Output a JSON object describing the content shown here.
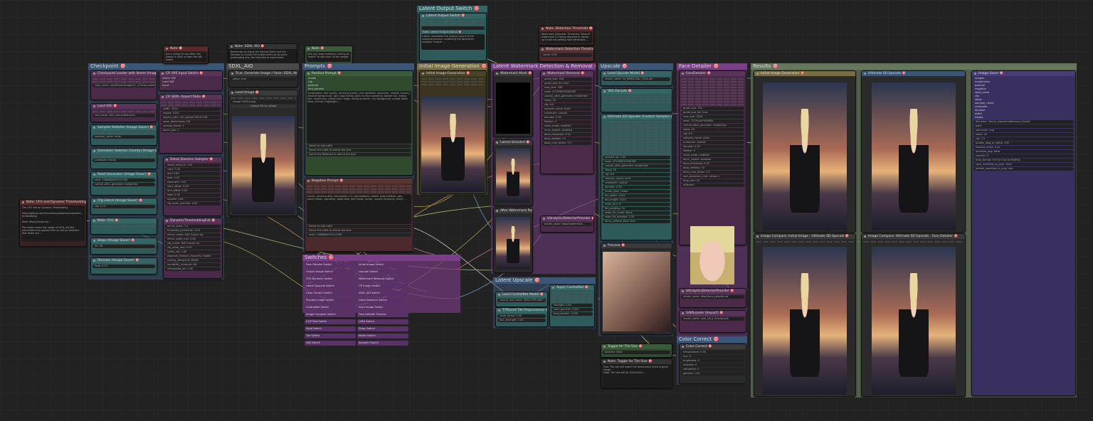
{
  "canvas": {
    "groups": {
      "checkpoint": "Checkpoint 🎯",
      "sdxl_aio": "SDXL_AIO",
      "prompts": "Prompts 🎯",
      "initial_gen": "Initial Image Generation 🎯",
      "watermark_removal": "Latent Watermark Detection & Removal 🎯",
      "upscale": "Upscale 🎯",
      "face_detailer": "Face Detailer 🎯",
      "results": "Results 🎯",
      "color_correct": "Color Correct 🎯",
      "latent_upscale": "Latent Upscale 🎯",
      "switches": "Switches 🎯"
    },
    "nodes": {
      "note_cfg": {
        "title": "Note: CFG and Dynamic Thresholding 🎯",
        "text": "The CFG Info on Dynamic Thresholding\n\nhttps://github.com/mcmonkeyprojects/sd-dynamic-thresholding\n\nNote: https://youtu.be/...\n\nThe video covers the usage of CFGs, but the parameters are applied here as well as samplers that make use ..."
      },
      "checkpoint_loader": {
        "title": "Checkpoint Loader with Name (Image Saver) 🎯",
        "ckpt": "ckpt_name: sdxl/DreamshaperXL_v2Turbo.safetensors"
      },
      "load_vae": {
        "title": "Load VAE 🎯",
        "vae": "vae_name: sdxl_vae.safetensors"
      },
      "sampler_selector": {
        "title": "Sampler Selector (Image Saver) 🎯",
        "sampler": "sampler_name: euler"
      },
      "scheduler_selector": {
        "title": "Scheduler Selector (Comfy) (Image Saver) 🎯",
        "scheduler": "scheduler: karras"
      },
      "seed_generator": {
        "title": "Seed Generator (Image Saver) 🎯",
        "seed": "seed: 1088884091512784",
        "control": "control_after_generate: randomize"
      },
      "cfg_literal": {
        "title": "Cfg Literal (Image Saver) 🎯",
        "cfg": "cfg: 11.0"
      },
      "note_cfg2": {
        "title": "Note: CFG 🎯"
      },
      "steps": {
        "title": "Steps (Image Saver) 🎯",
        "steps": "int: 28"
      },
      "denoise": {
        "title": "Denoise (Image Saver) 🎯",
        "denoise": "float: 0.70"
      },
      "cr_vae_switch": {
        "title": "CR VAE Input Switch 🎯",
        "inputs": [
          "Select VAE",
          "Load VAE",
          "Input"
        ]
      },
      "cr_sdxl_aspect": {
        "title": "CR SDXL Aspect Ratio 🎯",
        "width": "width: 1024",
        "height": "height: 1024",
        "aspect": "aspect_ratio: 4:5 portrait 832x1216",
        "swap": "swap_dimensions: Off",
        "upscale": "upscale_factor: 1",
        "batch": "batch_size: 1"
      },
      "detail_daemon": {
        "title": "Detail Daemon Sampler 🎯",
        "rows": [
          "detail_amount: 0.50",
          "start: 0.20",
          "end: 0.80",
          "bias: 0.50",
          "exponent: 1.00",
          "start_offset: 0.00",
          "end_offset: 0.00",
          "fade: 0.00",
          "smooth: true",
          "cfg_scale_override: 0.00"
        ]
      },
      "dynamic_threshold": {
        "title": "DynamicThresholdingFull 🎯",
        "rows": [
          "mimic_scale: 7.0",
          "threshold_percentile: 1.00",
          "mimic_mode: Half Cosine Up",
          "mimic_scale_min: 0.00",
          "cfg_mode: Half Cosine Up",
          "cfg_scale_min: 0.00",
          "sched_val: 1.00",
          "separate_feature_channels: enable",
          "scaling_startpoint: MEAN",
          "variability_measure: AD",
          "interpolate_phi: 1.00"
        ]
      },
      "note_sdxl": {
        "title": "Note: SDXL AIO 🎯"
      },
      "note_top1": {
        "title": "Note 🎯",
        "text": "Just a switch to say either the output is SDXL or from the VAE loader."
      },
      "note_top2": {
        "title": "Note: SDXL AIO 🎯",
        "text": "Remember to adjust the Sample Batch and the Denoise so usually the bright seems to do some preempting also, but that also to experiment."
      },
      "note_top3": {
        "title": "Note 🎯",
        "text": "Add your base model by clicking on \"select\" to add clips\" to the weight."
      },
      "true_generate": {
        "title": "True: Generate Image / False: SDXL AIO 🎯",
        "value": "value: true"
      },
      "load_image": {
        "title": "Load Image 🎯",
        "image": "image: 00024.png",
        "upload": "choose file to upload"
      },
      "positive_prompt": {
        "title": "Positive Prompt 🎯",
        "fields": [
          "model",
          "clip",
          "positive",
          "lora_params"
        ],
        "text": "masterpiece, best quality, amazing quality, very aesthetic, absurdres, newest, scenery, detailed background, 1girl, toga himiko, boku no hero academia, blonde hair, messy hair, double bun, yellow eyes, fangs, sitting on bench, city background, sunset, black dress, fishnet, thighhighs ..."
      },
      "lora_rows": {
        "a": "Select to add LoRA",
        "b": "Select the LoRA to add to the text",
        "c": "Select the Wildcard to add to the text"
      },
      "negative_prompt": {
        "title": "Negative Prompt 🎯",
        "text": "lowres, (worst quality, bad quality:1.2), bad anatomy, sketch, jpeg artifacts, ugly, poorly drawn, signature, watermark, bad hands, censor, mosaic censoring, blurry ..."
      },
      "seed_row": "seed: 1088884091512784",
      "latent_output_switch": {
        "title": "Latent Output Switch 🎯",
        "rows": [
          "Latent Output Switch 🎯",
          "Note: Latent Output Switch 🎯"
        ],
        "text": "Latent: represents the original output of the sampling process, containing the generated samples. Output: ..."
      },
      "initial_image": {
        "title": "Initial Image Generation 🎯"
      },
      "watermark_mask": {
        "title": "Watermark Mask 🎯"
      },
      "latent_detailed": {
        "title": "Latent Detailed 🎯"
      },
      "after_watermark": {
        "title": "After Watermark Removal 🎯"
      },
      "watermark_removal_node": {
        "title": "Watermark Removal 🎯",
        "rows": [
          "guide_size: 256",
          "guide_size_for: true",
          "max_size: 768",
          "seed: 472398349345382",
          "control_after_generate: randomize",
          "steps: 20",
          "cfg: 8.0",
          "sampler_name: euler",
          "scheduler: normal",
          "denoise: 0.50",
          "feather: 5",
          "noise_mask: enabled",
          "force_inpaint: enabled",
          "bbox_threshold: 0.50",
          "bbox_dilation: 10",
          "bbox_crop_factor: 3.0"
        ]
      },
      "note_watermark": {
        "title": "Note: Detection Threshold 🎯",
        "text": "Watermark Detection Threshold: Value of watermark 0.5 being detected or values up to but not getting false detections ..."
      },
      "watermark_threshold": {
        "title": "Watermark Detection Threshold 🎯",
        "value": "value: 0.50"
      },
      "ultralytics_provider": {
        "title": "UltralyticsDetectorProvider 🎯",
        "model": "model_name: bbox/watermark..."
      },
      "load_upscale": {
        "title": "Load Upscale Model 🎯",
        "model": "model_name: 4x_NMKD-Siax_200k.pth"
      },
      "sdxl_vae_decode": {
        "title": "VAE Decode 🎯"
      },
      "ultimate_sd_upscale": {
        "title": "Ultimate SD Upscale (Custom Sample) 🎯",
        "rows": [
          "upscale_by: 2.00",
          "seed: 472398349345382",
          "control_after_generate: randomize",
          "steps: 20",
          "cfg: 8.0",
          "sampler_name: euler",
          "scheduler: normal",
          "denoise: 0.20",
          "mode_type: Linear",
          "tile_width: 1024",
          "tile_height: 1024",
          "mask_blur: 8",
          "tile_padding: 32",
          "seam_fix_mode: None",
          "seam_fix_denoise: 1.00",
          "force_uniform_tiles: true"
        ]
      },
      "upscale_preview": {
        "title": "Preview 🎯"
      },
      "face_detailer_node": {
        "title": "FaceDetailer 🎯",
        "rows": [
          "guide_size: 512",
          "guide_size_for: true",
          "max_size: 1024",
          "seed: 72795447934586",
          "control_after_generate: randomize",
          "steps: 20",
          "cfg: 8.0",
          "sampler_name: euler",
          "scheduler: normal",
          "denoise: 0.50",
          "feather: 5",
          "noise_mask: enabled",
          "force_inpaint: enabled",
          "bbox_threshold: 0.50",
          "bbox_dilation: 10",
          "bbox_crop_factor: 3.0",
          "sam_detection_hint: center-1",
          "drop_size: 10",
          "wildcard: "
        ]
      },
      "face_preview": {
        "title": "Preview 🎯"
      },
      "ultralytics_face": {
        "title": "UltralyticsDetectorProvider 🎯",
        "model": "model_name: bbox/face_yolov8m.pt"
      },
      "sam_loader": {
        "title": "SAMLoader (Impact) 🎯",
        "model": "model_name: sam_vit_b_01ec64.pth"
      },
      "color_correct_node": {
        "title": "Color Correct 🎯",
        "rows": [
          "temperature: 0.00",
          "hue: 0",
          "brightness: 0",
          "contrast: 0",
          "saturation: 0",
          "gamma: 1.00"
        ]
      },
      "load_controlnet": {
        "title": "Load ControlNet Model 🎯",
        "model": "control_net_name: SDXL/TTPLANET..."
      },
      "apply_controlnet": {
        "title": "Apply ControlNet 🎯",
        "rows": [
          "strength: 0.60",
          "start_percent: 0.000",
          "end_percent: 1.000"
        ]
      },
      "ttp_tile": {
        "title": "TTPlanet Tile Preprocessor Simple 🎯",
        "rows": [
          "scale_factor: 2.00",
          "blur_strength: 2.00"
        ]
      },
      "toggle_tile": {
        "title": "Toggle for Tile Size 🎯",
        "value": "boolean: false"
      },
      "note_tile": {
        "title": "Note: Toggle for Tile Size 🎯",
        "text": "True: Tile size will match the dimensions of the original image\nFalse: Tile size will be 1024x1024 ..."
      },
      "result_initial": {
        "title": "Initial Image Generation 🎯"
      },
      "result_ultimate": {
        "title": "Ultimate SD Upscale 🎯"
      },
      "compare1": {
        "title": "Image Compare: Initial Image - Ultimate SD Upscale 🎯"
      },
      "compare2": {
        "title": "Image Compare: Ultimate SD Upscale - Face Detailer 🎯"
      },
      "image_saver": {
        "title": "Image Saver 🎯",
        "inputs": [
          "images",
          "modelname",
          "positive",
          "negative",
          "seed_value",
          "cfg",
          "steps",
          "sampler_name",
          "scheduler",
          "denoise",
          "width",
          "height"
        ],
        "rows": [
          "filename: %time_%basemodelname_%seed",
          "path: ",
          "extension: png",
          "steps: 20",
          "cfg: 7.0",
          "quality_jpeg_or_webp: 100",
          "lossless_webp: true",
          "optimize_png: false",
          "counter: 0",
          "time_format: %Y-%m-%d-%H%M%S",
          "save_workflow_as_json: false",
          "embed_workflow_in_png: true"
        ]
      },
      "switch_labels": [
        "Face Detailer Switch",
        "Initial Image Switch",
        "Output Image Switch",
        "Upscale Switch",
        "CFG Dynamic Switch",
        "Watermark Removal Switch",
        "Latent Upscale Switch",
        "CR Image Switch",
        "Color Correct Switch",
        "SDXL AIO Switch",
        "Preview Image Switch",
        "Detail Daemon Switch",
        "ControlNet Switch",
        "Save Image Switch",
        "Image Compare Switch",
        "Face Detailer Preview",
        "CLIP Text Switch",
        "LoRA Switch",
        "Seed Switch",
        "Steps Switch",
        "Tile Switch",
        "Model Switch",
        "VAE Switch",
        "Sampler Switch"
      ]
    }
  },
  "colors": {
    "canvas_bg": "#222222",
    "blue_group": "#3a5778",
    "purple_group": "#6d3a7a",
    "olive_group": "#5b6b52",
    "teal_node": "#2f5a5a",
    "plum_node": "#4a2a48"
  }
}
